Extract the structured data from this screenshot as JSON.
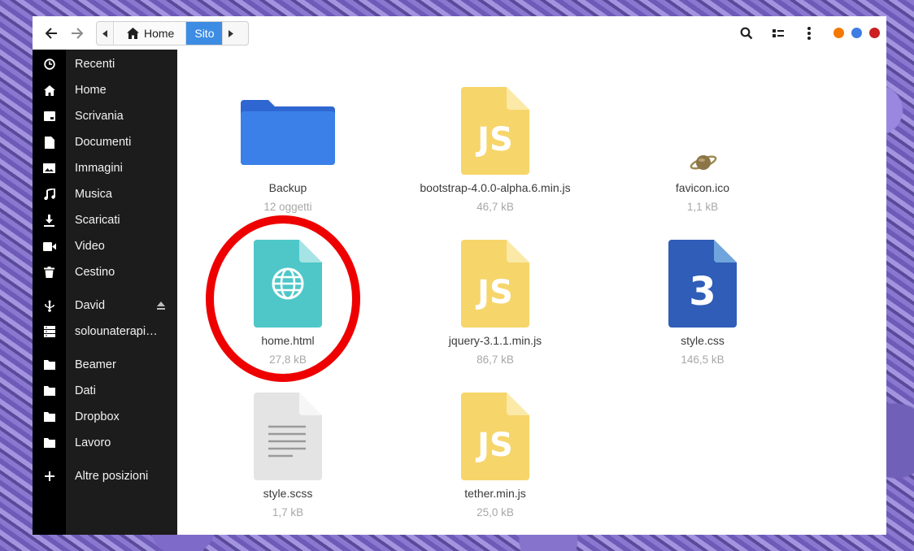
{
  "header": {
    "back_icon": "arrow-left-icon",
    "forward_icon": "arrow-right-icon",
    "path": {
      "home_label": "Home",
      "current_label": "Sito"
    },
    "actions": [
      "search-icon",
      "view-list-icon",
      "menu-kebab-icon"
    ],
    "window_controls": [
      {
        "name": "minimize",
        "color": "#f57900"
      },
      {
        "name": "maximize",
        "color": "#3d7de4"
      },
      {
        "name": "close",
        "color": "#cc1f1f"
      }
    ]
  },
  "sidebar": {
    "items": [
      {
        "label": "Recenti",
        "icon": "clock-icon"
      },
      {
        "label": "Home",
        "icon": "home-icon"
      },
      {
        "label": "Scrivania",
        "icon": "desktop-icon"
      },
      {
        "label": "Documenti",
        "icon": "document-icon"
      },
      {
        "label": "Immagini",
        "icon": "image-icon"
      },
      {
        "label": "Musica",
        "icon": "music-icon"
      },
      {
        "label": "Scaricati",
        "icon": "download-icon"
      },
      {
        "label": "Video",
        "icon": "video-icon"
      },
      {
        "label": "Cestino",
        "icon": "trash-icon"
      }
    ],
    "devices": [
      {
        "label": "David",
        "icon": "usb-icon",
        "eject": true
      },
      {
        "label": "solounaterapia.it",
        "icon": "server-icon"
      }
    ],
    "bookmarks": [
      {
        "label": "Beamer",
        "icon": "folder-icon"
      },
      {
        "label": "Dati",
        "icon": "folder-icon"
      },
      {
        "label": "Dropbox",
        "icon": "folder-icon"
      },
      {
        "label": "Lavoro",
        "icon": "folder-icon"
      }
    ],
    "other": {
      "label": "Altre posizioni",
      "icon": "plus-icon"
    }
  },
  "files": [
    {
      "name": "Backup",
      "meta": "12 oggetti",
      "type": "folder"
    },
    {
      "name": "bootstrap-4.0.0-alpha.6.min.js",
      "meta": "46,7 kB",
      "type": "js"
    },
    {
      "name": "favicon.ico",
      "meta": "1,1 kB",
      "type": "ico"
    },
    {
      "name": "home.html",
      "meta": "27,8 kB",
      "type": "html"
    },
    {
      "name": "jquery-3.1.1.min.js",
      "meta": "86,7 kB",
      "type": "js"
    },
    {
      "name": "style.css",
      "meta": "146,5 kB",
      "type": "css"
    },
    {
      "name": "style.scss",
      "meta": "1,7 kB",
      "type": "text"
    },
    {
      "name": "tether.min.js",
      "meta": "25,0 kB",
      "type": "js"
    }
  ],
  "icon_text": {
    "js": "JS",
    "css": "3"
  }
}
